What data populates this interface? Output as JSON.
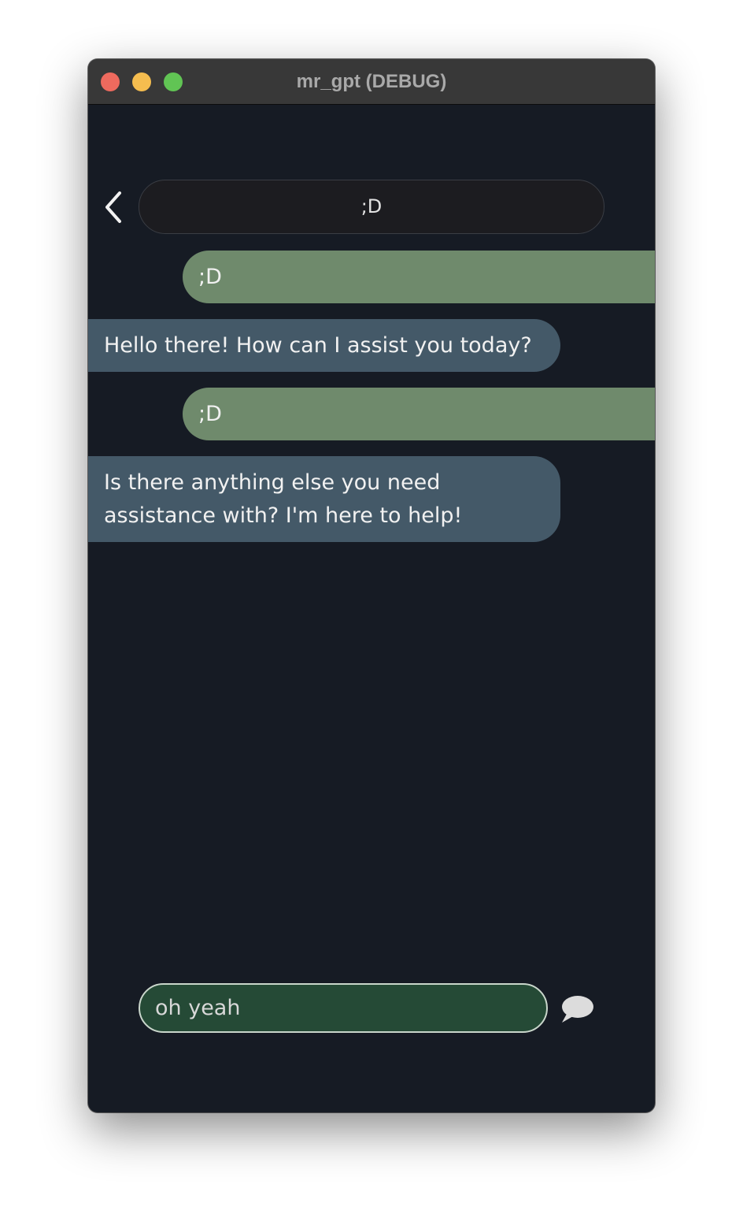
{
  "window": {
    "title": "mr_gpt (DEBUG)"
  },
  "header": {
    "back_icon": "chevron-left-icon",
    "conversation_title": ";D"
  },
  "messages": [
    {
      "role": "user",
      "text": ";D"
    },
    {
      "role": "assistant",
      "text": "Hello there! How can I assist you today?"
    },
    {
      "role": "user",
      "text": ";D"
    },
    {
      "role": "assistant",
      "text": "Is there anything else you need assistance with? I'm here to help!"
    }
  ],
  "composer": {
    "value": "oh yeah",
    "send_icon": "speech-bubble-icon"
  },
  "colors": {
    "background": "#161b24",
    "user_bubble": "#6f8a6c",
    "assistant_bubble": "#445968",
    "composer_fill": "#254a36"
  }
}
